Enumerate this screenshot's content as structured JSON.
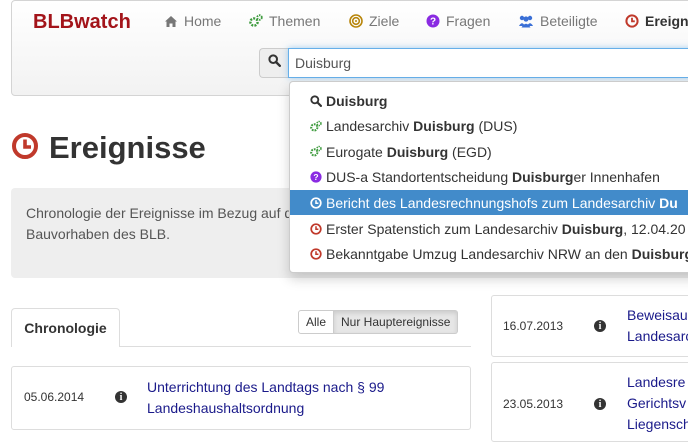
{
  "brand": "BLBwatch",
  "nav": [
    {
      "label": "Home",
      "icon": "home-icon"
    },
    {
      "label": "Themen",
      "icon": "cogs-icon"
    },
    {
      "label": "Ziele",
      "icon": "bullseye-icon"
    },
    {
      "label": "Fragen",
      "icon": "question-circle-icon"
    },
    {
      "label": "Beteiligte",
      "icon": "users-icon"
    },
    {
      "label": "Ereignis",
      "icon": "clock-icon"
    }
  ],
  "search": {
    "value": "Duisburg",
    "icon": "search-icon"
  },
  "page": {
    "title": "Ereignisse",
    "title_icon": "clock-icon"
  },
  "intro": {
    "line1": "Chronologie der Ereignisse im Bezug auf d",
    "line2": "Bauvorhaben des BLB."
  },
  "tabs": {
    "chronologie": "Chronologie"
  },
  "filters": {
    "alle": "Alle",
    "haupt": "Nur Hauptereignisse"
  },
  "left_events": [
    {
      "date": "05.06.2014",
      "line1": "Unterrichtung des Landtags nach § 99",
      "line2": "Landeshaushaltsordnung"
    }
  ],
  "right_events": [
    {
      "date": "16.07.2013",
      "line1": "Beweisau",
      "line2": "Landesarc"
    },
    {
      "date": "23.05.2013",
      "line1": "Landesre",
      "line2": "Gerichtsv",
      "line3": "Liegensch"
    }
  ],
  "dropdown": [
    {
      "icon": "search-icon",
      "pre": "",
      "bold": "Duisburg",
      "post": "",
      "color": "#333333",
      "active": false
    },
    {
      "icon": "cogs-icon",
      "pre": "Landesarchiv ",
      "bold": "Duisburg",
      "post": " (DUS)",
      "color": "#3c9a3c",
      "active": false
    },
    {
      "icon": "cogs-icon",
      "pre": "Eurogate ",
      "bold": "Duisburg",
      "post": " (EGD)",
      "color": "#3c9a3c",
      "active": false
    },
    {
      "icon": "question-circle-icon",
      "pre": "DUS-a Standortentscheidung ",
      "bold": "Duisburg",
      "post": "er Innenhafen",
      "color": "#8a2be2",
      "active": false
    },
    {
      "icon": "clock-icon",
      "pre": "Bericht des Landesrechnungshofs zum Landesarchiv ",
      "bold": "Du",
      "post": "",
      "color": "#c0392b",
      "active": true
    },
    {
      "icon": "clock-icon",
      "pre": "Erster Spatenstich zum Landesarchiv ",
      "bold": "Duisburg",
      "post": ", 12.04.20",
      "color": "#c0392b",
      "active": false
    },
    {
      "icon": "clock-icon",
      "pre": "Bekanntgabe Umzug Landesarchiv NRW an den ",
      "bold": "Duisburg",
      "post": "",
      "color": "#c0392b",
      "active": false
    }
  ],
  "colors": {
    "brand": "#a3141a",
    "link": "#1a1a8a",
    "active": "#428bca",
    "green": "#3c9a3c",
    "purple": "#8a2be2",
    "red": "#c0392b",
    "orange": "#b8860b",
    "blue": "#3a6fd6"
  }
}
